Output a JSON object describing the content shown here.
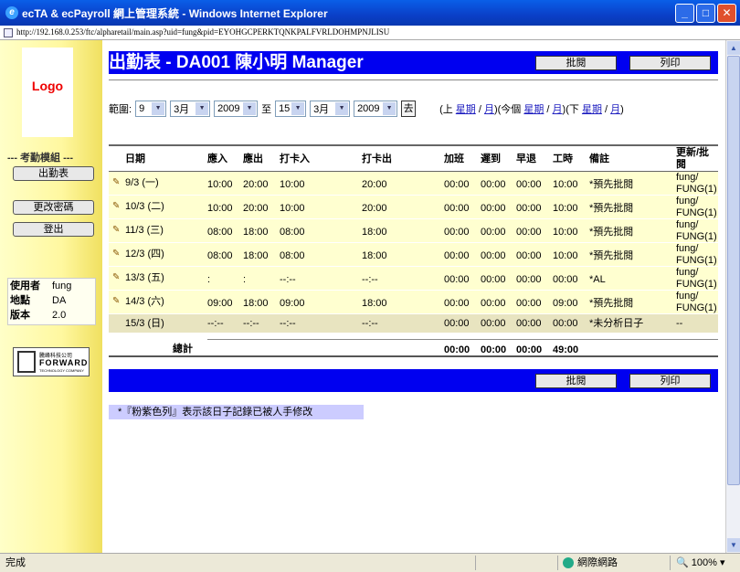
{
  "window": {
    "title": "ecTA & ecPayroll 網上管理系統 - Windows Internet Explorer",
    "url": "http://192.168.0.253/ftc/alpharetail/main.asp?uid=fung&pid=EYOHGCPERKTQNKPALFVRLDOHMPNJLISU"
  },
  "sidebar": {
    "logo": "Logo",
    "module_title": "--- 考勤模組 ---",
    "buttons": [
      "出勤表",
      "更改密碼",
      "登出"
    ],
    "info": [
      {
        "label": "使用者",
        "value": "fung"
      },
      {
        "label": "地點",
        "value": "DA"
      },
      {
        "label": "版本",
        "value": "2.0"
      }
    ],
    "company": {
      "top": "騰峰科技公司",
      "brand": "FORWARD",
      "sub": "TECHNOLOGY COMPANY"
    }
  },
  "page": {
    "title": "出勤表 - DA001 陳小明 Manager",
    "approve_label": "批閱",
    "print_label": "列印"
  },
  "range": {
    "label": "範圍:",
    "from_day": "9",
    "from_month": "3月",
    "from_year": "2009",
    "to_label": "至",
    "to_day": "15",
    "to_month": "3月",
    "to_year": "2009",
    "go_label": "去",
    "nav_prev": "(上",
    "nav_cur": "(今個",
    "nav_next": "(下",
    "week": "星期",
    "month": "月",
    "slash": " / ",
    "close": ")"
  },
  "table": {
    "headers": [
      "日期",
      "應入",
      "應出",
      "打卡入",
      "打卡出",
      "加班",
      "遲到",
      "早退",
      "工時",
      "備註",
      "更新/批閱"
    ],
    "rows": [
      {
        "date": "9/3 (一)",
        "in": "10:00",
        "out": "20:00",
        "pin": "10:00",
        "pout": "20:00",
        "ot": "00:00",
        "late": "00:00",
        "early": "00:00",
        "hrs": "10:00",
        "remark": "*預先批閱",
        "upd1": "fung/",
        "upd2": "FUNG(1)",
        "edit": true
      },
      {
        "date": "10/3 (二)",
        "in": "10:00",
        "out": "20:00",
        "pin": "10:00",
        "pout": "20:00",
        "ot": "00:00",
        "late": "00:00",
        "early": "00:00",
        "hrs": "10:00",
        "remark": "*預先批閱",
        "upd1": "fung/",
        "upd2": "FUNG(1)",
        "edit": true
      },
      {
        "date": "11/3 (三)",
        "in": "08:00",
        "out": "18:00",
        "pin": "08:00",
        "pout": "18:00",
        "ot": "00:00",
        "late": "00:00",
        "early": "00:00",
        "hrs": "10:00",
        "remark": "*預先批閱",
        "upd1": "fung/",
        "upd2": "FUNG(1)",
        "edit": true
      },
      {
        "date": "12/3 (四)",
        "in": "08:00",
        "out": "18:00",
        "pin": "08:00",
        "pout": "18:00",
        "ot": "00:00",
        "late": "00:00",
        "early": "00:00",
        "hrs": "10:00",
        "remark": "*預先批閱",
        "upd1": "fung/",
        "upd2": "FUNG(1)",
        "edit": true
      },
      {
        "date": "13/3 (五)",
        "in": ":",
        "out": ":",
        "pin": "--:--",
        "pout": "--:--",
        "ot": "00:00",
        "late": "00:00",
        "early": "00:00",
        "hrs": "00:00",
        "remark": "*AL",
        "upd1": "fung/",
        "upd2": "FUNG(1)",
        "edit": true
      },
      {
        "date": "14/3 (六)",
        "in": "09:00",
        "out": "18:00",
        "pin": "09:00",
        "pout": "18:00",
        "ot": "00:00",
        "late": "00:00",
        "early": "00:00",
        "hrs": "09:00",
        "remark": "*預先批閱",
        "upd1": "fung/",
        "upd2": "FUNG(1)",
        "edit": true
      },
      {
        "date": "15/3 (日)",
        "in": "--:--",
        "out": "--:--",
        "pin": "--:--",
        "pout": "--:--",
        "ot": "00:00",
        "late": "00:00",
        "early": "00:00",
        "hrs": "00:00",
        "remark": "*未分析日子",
        "upd1": "--",
        "upd2": "",
        "edit": false
      }
    ],
    "total_label": "總計",
    "total": {
      "ot": "00:00",
      "late": "00:00",
      "early": "00:00",
      "hrs": "49:00"
    }
  },
  "note": "*『粉紫色列』表示該日子記錄已被人手修改",
  "statusbar": {
    "done": "完成",
    "zone": "網際網路",
    "zoom": "100%"
  },
  "colors": {
    "row_bg": "#ffffd0",
    "row_alt": "#e8e4c0",
    "blue": "#0000f0",
    "note_bg": "#ccccff"
  }
}
